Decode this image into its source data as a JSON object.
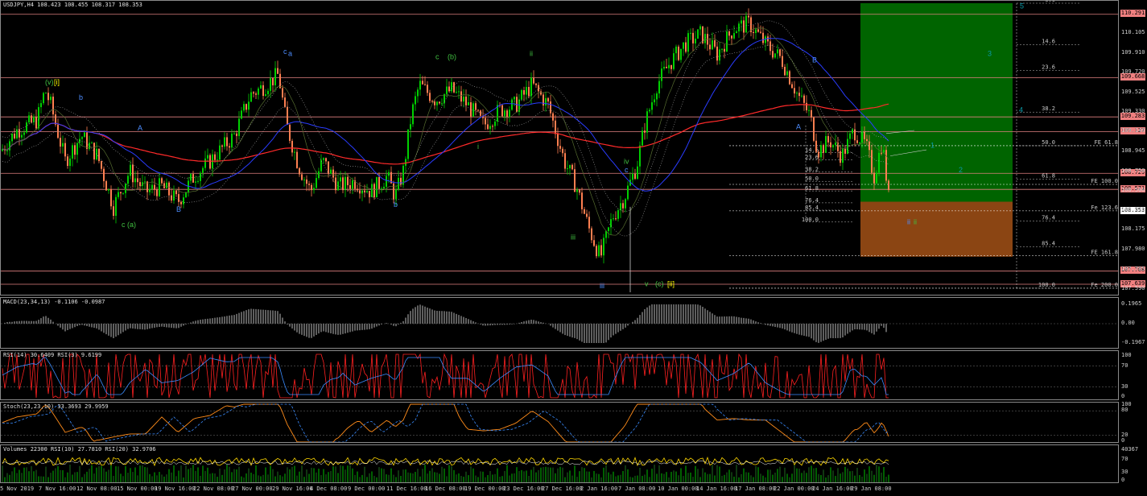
{
  "main": {
    "title": "USDJPY,H4  108.423 108.455 108.317 108.353",
    "ylim": [
      107.56,
      110.4
    ],
    "current_price": 108.353,
    "price_ticks": [
      "110.105",
      "109.910",
      "109.720",
      "109.525",
      "109.330",
      "109.140",
      "108.945",
      "108.750",
      "108.560",
      "108.370",
      "108.175",
      "107.980",
      "107.785",
      "107.590"
    ],
    "hlines": [
      {
        "price": 110.291,
        "label": "110.291"
      },
      {
        "price": 109.668,
        "label": "109.668"
      },
      {
        "price": 109.283,
        "label": "109.283"
      },
      {
        "price": 109.137,
        "label": "109.137"
      },
      {
        "price": 108.729,
        "label": "108.729"
      },
      {
        "price": 108.571,
        "label": "108.571"
      },
      {
        "price": 107.768,
        "label": "107.768"
      },
      {
        "price": 107.639,
        "label": "107.639"
      }
    ],
    "current_label": "108.353",
    "fe_levels": [
      {
        "price": 109.0,
        "label": "FE 61.8"
      },
      {
        "price": 108.62,
        "label": "FE 100.0"
      },
      {
        "price": 108.36,
        "label": "Fe 123.6"
      },
      {
        "price": 107.92,
        "label": "FE 161.8"
      },
      {
        "price": 107.6,
        "label": "Fe 200.0"
      }
    ],
    "fib_right": [
      "0.0",
      "14.6",
      "23.6",
      "38.2",
      "50.0",
      "61.8",
      "76.4",
      "85.4",
      "100.0"
    ],
    "fib_mid": [
      "14.6",
      "23.6",
      "38.2",
      "50.0",
      "61.8",
      "76.4",
      "85.4",
      "100.0"
    ],
    "wave_labels_green": [
      "(v)",
      "[i]",
      "c",
      "(b)",
      "ii",
      "iii",
      "iv",
      "v",
      "(c)",
      "[ii]",
      "c (a)",
      "i",
      "ii",
      "2",
      "3",
      "4",
      "5",
      "1"
    ],
    "wave_labels_blue": [
      "a",
      "b",
      "c",
      "A",
      "B",
      "b",
      "c",
      "ii",
      "iii",
      "A",
      "B"
    ]
  },
  "macd": {
    "title": "MACD(23,34,13) -0.1106 -0.0987",
    "ticks": [
      "0.1965",
      "0.00",
      "-0.1967"
    ]
  },
  "rsi": {
    "title": "RSI(14) 30.6409  RSI(3) 9.6199",
    "ticks": [
      "100",
      "70",
      "30",
      "0"
    ]
  },
  "stoch": {
    "title": "Stoch(23,23,10) 33.3693 29.9959",
    "ticks": [
      "100",
      "80",
      "20",
      "0"
    ]
  },
  "volume": {
    "title": "Volumes 22300  RSI(10) 27.7810  RSI(20) 32.9706",
    "ticks": [
      "40367",
      "70",
      "30",
      "0"
    ]
  },
  "x_labels": [
    "5 Nov 2019",
    "7 Nov 16:00",
    "12 Nov 08:00",
    "15 Nov 00:00",
    "19 Nov 16:00",
    "22 Nov 08:00",
    "27 Nov 00:00",
    "29 Nov 16:00",
    "4 Dec 08:00",
    "9 Dec 00:00",
    "11 Dec 16:00",
    "16 Dec 08:00",
    "19 Dec 00:00",
    "23 Dec 16:00",
    "27 Dec 16:00",
    "2 Jan 16:00",
    "7 Jan 08:00",
    "10 Jan 00:00",
    "14 Jan 16:00",
    "17 Jan 08:00",
    "22 Jan 00:00",
    "24 Jan 16:00",
    "29 Jan 08:00"
  ],
  "chart_data": {
    "type": "candlestick",
    "symbol": "USDJPY",
    "timeframe": "H4",
    "close_path": [
      [
        0,
        108.95
      ],
      [
        20,
        109.15
      ],
      [
        45,
        109.25
      ],
      [
        55,
        109.55
      ],
      [
        62,
        109.4
      ],
      [
        80,
        108.85
      ],
      [
        100,
        109.1
      ],
      [
        120,
        108.9
      ],
      [
        140,
        108.4
      ],
      [
        160,
        108.75
      ],
      [
        180,
        108.55
      ],
      [
        200,
        108.6
      ],
      [
        220,
        108.45
      ],
      [
        240,
        108.7
      ],
      [
        260,
        108.85
      ],
      [
        290,
        109.1
      ],
      [
        310,
        109.5
      ],
      [
        330,
        109.6
      ],
      [
        345,
        109.7
      ],
      [
        355,
        109.2
      ],
      [
        370,
        108.8
      ],
      [
        385,
        108.55
      ],
      [
        400,
        108.85
      ],
      [
        420,
        108.6
      ],
      [
        440,
        108.65
      ],
      [
        460,
        108.55
      ],
      [
        480,
        108.7
      ],
      [
        490,
        108.5
      ],
      [
        500,
        108.75
      ],
      [
        510,
        109.3
      ],
      [
        520,
        109.6
      ],
      [
        540,
        109.45
      ],
      [
        560,
        109.55
      ],
      [
        580,
        109.4
      ],
      [
        600,
        109.2
      ],
      [
        620,
        109.35
      ],
      [
        640,
        109.4
      ],
      [
        660,
        109.6
      ],
      [
        680,
        109.4
      ],
      [
        700,
        108.85
      ],
      [
        715,
        108.6
      ],
      [
        730,
        108.2
      ],
      [
        745,
        107.9
      ],
      [
        760,
        108.3
      ],
      [
        775,
        108.5
      ],
      [
        790,
        108.8
      ],
      [
        800,
        109.2
      ],
      [
        815,
        109.6
      ],
      [
        830,
        109.8
      ],
      [
        850,
        110.0
      ],
      [
        870,
        110.1
      ],
      [
        890,
        109.9
      ],
      [
        910,
        110.15
      ],
      [
        930,
        110.2
      ],
      [
        950,
        110.0
      ],
      [
        970,
        109.85
      ],
      [
        990,
        109.5
      ],
      [
        1005,
        109.3
      ],
      [
        1015,
        108.95
      ],
      [
        1030,
        109.05
      ],
      [
        1045,
        108.9
      ],
      [
        1060,
        109.15
      ],
      [
        1075,
        109.0
      ],
      [
        1085,
        108.7
      ],
      [
        1095,
        109.05
      ],
      [
        1105,
        108.35
      ]
    ],
    "moving_averages": [
      {
        "name": "MA red",
        "color": "#ff2a2a"
      },
      {
        "name": "MA blue",
        "color": "#2a3cff"
      }
    ],
    "target_box": {
      "price_top": 110.4,
      "price_split": 108.45,
      "price_bottom": 107.91,
      "colors": [
        "#006400",
        "#8b4513"
      ]
    },
    "ylim": [
      107.56,
      110.4
    ]
  }
}
